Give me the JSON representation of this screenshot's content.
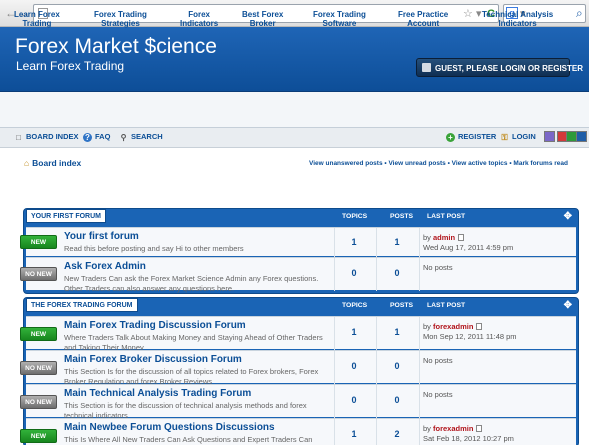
{
  "browser": {
    "nav_back": "←",
    "nav_forward": "→",
    "star": "☆",
    "dropdown": "▾",
    "reload": "C",
    "search_engine": "g",
    "search_glyph": "⌕"
  },
  "header": {
    "title": "Forex Market $cience",
    "tagline": "Learn Forex Trading",
    "guest_text": "GUEST, PLEASE LOGIN OR REGISTER"
  },
  "nav": [
    {
      "line1": "Learn Forex",
      "line2": "Trading"
    },
    {
      "line1": "Forex Trading",
      "line2": "Strategies"
    },
    {
      "line1": "Forex",
      "line2": "Indicators"
    },
    {
      "line1": "Best Forex",
      "line2": "Broker"
    },
    {
      "line1": "Forex Trading",
      "line2": "Software"
    },
    {
      "line1": "Free Practice",
      "line2": "Account"
    },
    {
      "line1": "Technical Analysis",
      "line2": "Indicators"
    }
  ],
  "toolbar": {
    "board_index": "BOARD INDEX",
    "faq": "FAQ",
    "search": "SEARCH",
    "register": "REGISTER",
    "login": "LOGIN",
    "swatches": [
      "#7b68c8",
      "#d33a3a",
      "#2e9a3a",
      "#1f5ea8"
    ]
  },
  "breadcrumb": "Board index",
  "quick_links": "View unanswered posts • View unread posts • View active topics • Mark forums read",
  "headers": {
    "topics": "TOPICS",
    "posts": "POSTS",
    "last_post": "LAST POST"
  },
  "status": {
    "new": "NEW",
    "old": "NO NEW"
  },
  "categories": [
    {
      "name": "YOUR FIRST FORUM",
      "forums": [
        {
          "title": "Your first forum",
          "desc": "Read this before posting and say Hi to other members",
          "topics": "1",
          "posts": "1",
          "new": true,
          "last_by": "by",
          "last_user": "admin",
          "last_date": "Wed Aug 17, 2011 4:59 pm"
        },
        {
          "title": "Ask Forex Admin",
          "desc": "New Traders Can ask the Forex Market Science Admin any Forex questions. Other Traders can also answer any questions here.",
          "topics": "0",
          "posts": "0",
          "new": false,
          "no_posts": "No posts"
        }
      ]
    },
    {
      "name": "THE FOREX TRADING FORUM",
      "forums": [
        {
          "title": "Main Forex Trading Discussion Forum",
          "desc": "Where Traders Talk About Making Money and Staying Ahead of Other Traders and Taking Their Money",
          "topics": "1",
          "posts": "1",
          "new": true,
          "last_by": "by",
          "last_user": "forexadmin",
          "last_date": "Mon Sep 12, 2011 11:48 pm"
        },
        {
          "title": "Main Forex Broker Discussion Forum",
          "desc": "This Section Is for the discussion of all topics related to Forex brokers, Forex Broker Regulation and forex Broker Reviews",
          "topics": "0",
          "posts": "0",
          "new": false,
          "no_posts": "No posts"
        },
        {
          "title": "Main Technical Analysis Trading Forum",
          "desc": "This Section is for the discussion of technical analysis methods and forex technical indicators",
          "topics": "0",
          "posts": "0",
          "new": false,
          "no_posts": "No posts"
        },
        {
          "title": "Main Newbee Forum Questions Discussions",
          "desc": "This Is Where All New Traders Can Ask Questions and Expert Traders Can Answer and Help Out New Traders",
          "topics": "1",
          "posts": "2",
          "new": true,
          "last_by": "by",
          "last_user": "forexadmin",
          "last_date": "Sat Feb 18, 2012 10:27 pm"
        }
      ]
    }
  ]
}
